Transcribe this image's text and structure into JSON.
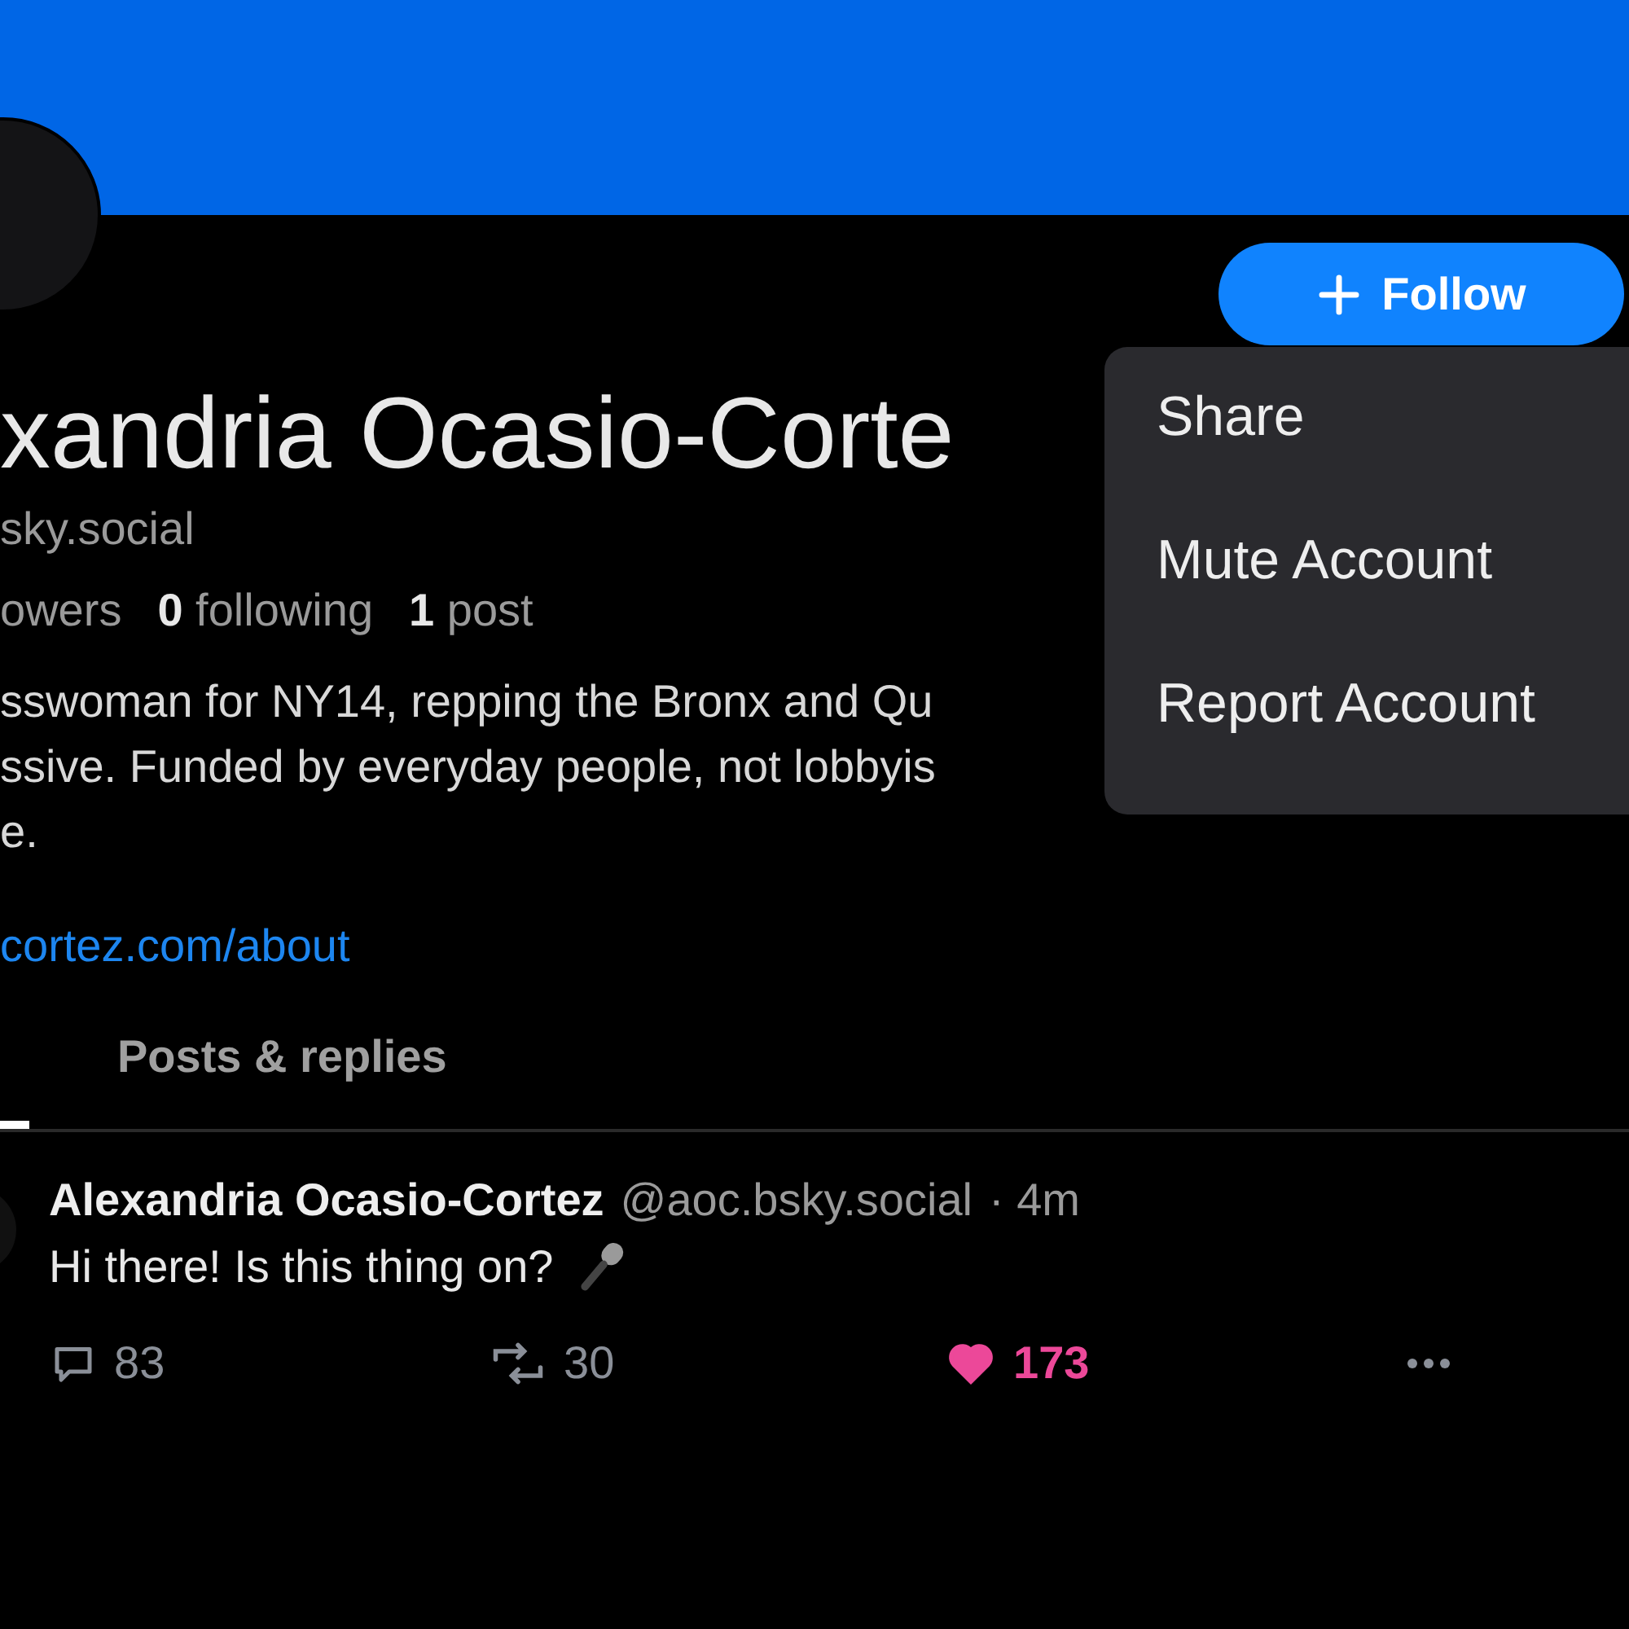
{
  "profile": {
    "name": "xandria Ocasio-Corte",
    "handle": "sky.social",
    "stats": [
      "owers",
      "**0** following",
      "**1** post"
    ],
    "bio": [
      "sswoman for NY14, repping the Bronx and Qu",
      "ssive. Funded by everyday people, not lobbyis",
      "e."
    ],
    "link": "cortez.com/about"
  },
  "follow_button": {
    "label": "Follow"
  },
  "menu": {
    "items": [
      "Share",
      "Mute Account",
      "Report Account"
    ]
  },
  "tabs": [
    {
      "selected": true
    },
    {
      "label": "Posts & replies",
      "selected": false
    }
  ],
  "post": {
    "author": "Alexandria Ocasio-Cortez",
    "handle": "@aoc.bsky.social",
    "time": "· 4m",
    "text": "Hi there! Is this thing on?",
    "replies": "83",
    "reposts": "30",
    "likes": "173",
    "liked": true
  }
}
